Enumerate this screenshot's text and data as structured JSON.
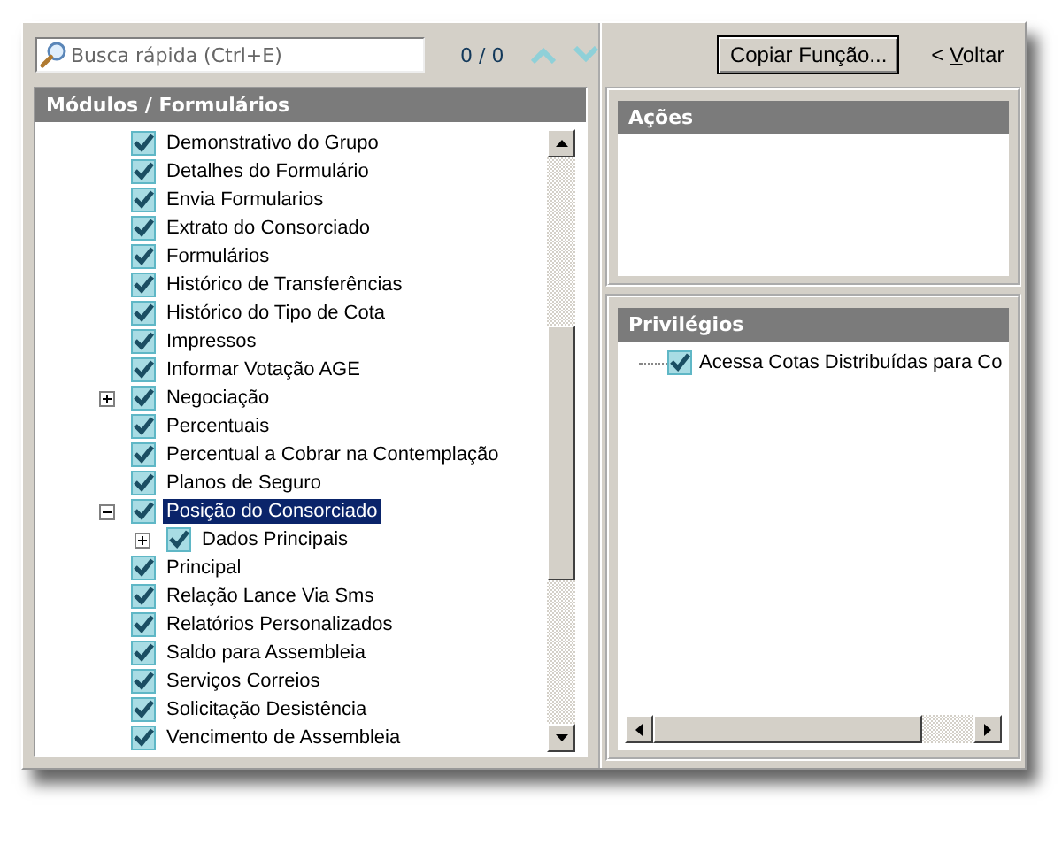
{
  "search": {
    "placeholder": "Busca rápida (Ctrl+E)",
    "count": "0 / 0"
  },
  "modules": {
    "title": "Módulos / Formulários",
    "items": [
      {
        "label": "Demonstrativo do Grupo",
        "checked": true,
        "selected": false,
        "kind": "leaf"
      },
      {
        "label": "Detalhes do Formulário",
        "checked": true,
        "selected": false,
        "kind": "leaf"
      },
      {
        "label": "Envia Formularios",
        "checked": true,
        "selected": false,
        "kind": "leaf"
      },
      {
        "label": "Extrato do Consorciado",
        "checked": true,
        "selected": false,
        "kind": "leaf"
      },
      {
        "label": "Formulários",
        "checked": true,
        "selected": false,
        "kind": "leaf"
      },
      {
        "label": "Histórico de Transferências",
        "checked": true,
        "selected": false,
        "kind": "leaf"
      },
      {
        "label": "Histórico do Tipo de Cota",
        "checked": true,
        "selected": false,
        "kind": "leaf"
      },
      {
        "label": "Impressos",
        "checked": true,
        "selected": false,
        "kind": "leaf"
      },
      {
        "label": "Informar Votação AGE",
        "checked": true,
        "selected": false,
        "kind": "leaf"
      },
      {
        "label": "Negociação",
        "checked": true,
        "selected": false,
        "kind": "branch",
        "expanded": false
      },
      {
        "label": "Percentuais",
        "checked": true,
        "selected": false,
        "kind": "leaf"
      },
      {
        "label": "Percentual a Cobrar na Contemplação",
        "checked": true,
        "selected": false,
        "kind": "leaf"
      },
      {
        "label": "Planos de Seguro",
        "checked": true,
        "selected": false,
        "kind": "leaf"
      },
      {
        "label": "Posição do Consorciado",
        "checked": true,
        "selected": true,
        "kind": "branch",
        "expanded": true,
        "children": [
          {
            "label": "Dados Principais",
            "checked": true,
            "selected": false,
            "kind": "branch",
            "expanded": false
          }
        ]
      },
      {
        "label": "Principal",
        "checked": true,
        "selected": false,
        "kind": "leaf"
      },
      {
        "label": "Relação Lance Via Sms",
        "checked": true,
        "selected": false,
        "kind": "leaf"
      },
      {
        "label": "Relatórios Personalizados",
        "checked": true,
        "selected": false,
        "kind": "leaf"
      },
      {
        "label": "Saldo para Assembleia",
        "checked": true,
        "selected": false,
        "kind": "leaf"
      },
      {
        "label": "Serviços Correios",
        "checked": true,
        "selected": false,
        "kind": "leaf"
      },
      {
        "label": "Solicitação Desistência",
        "checked": true,
        "selected": false,
        "kind": "leaf"
      },
      {
        "label": "Vencimento de Assembleia",
        "checked": true,
        "selected": false,
        "kind": "leaf"
      }
    ]
  },
  "copy_button": "Copiar Função...",
  "back_link": {
    "arrow": "<",
    "label": "Voltar"
  },
  "actions": {
    "title": "Ações"
  },
  "privileges": {
    "title": "Privilégios",
    "items": [
      {
        "label": "Acessa Cotas Distribuídas para Co",
        "checked": true
      }
    ]
  }
}
